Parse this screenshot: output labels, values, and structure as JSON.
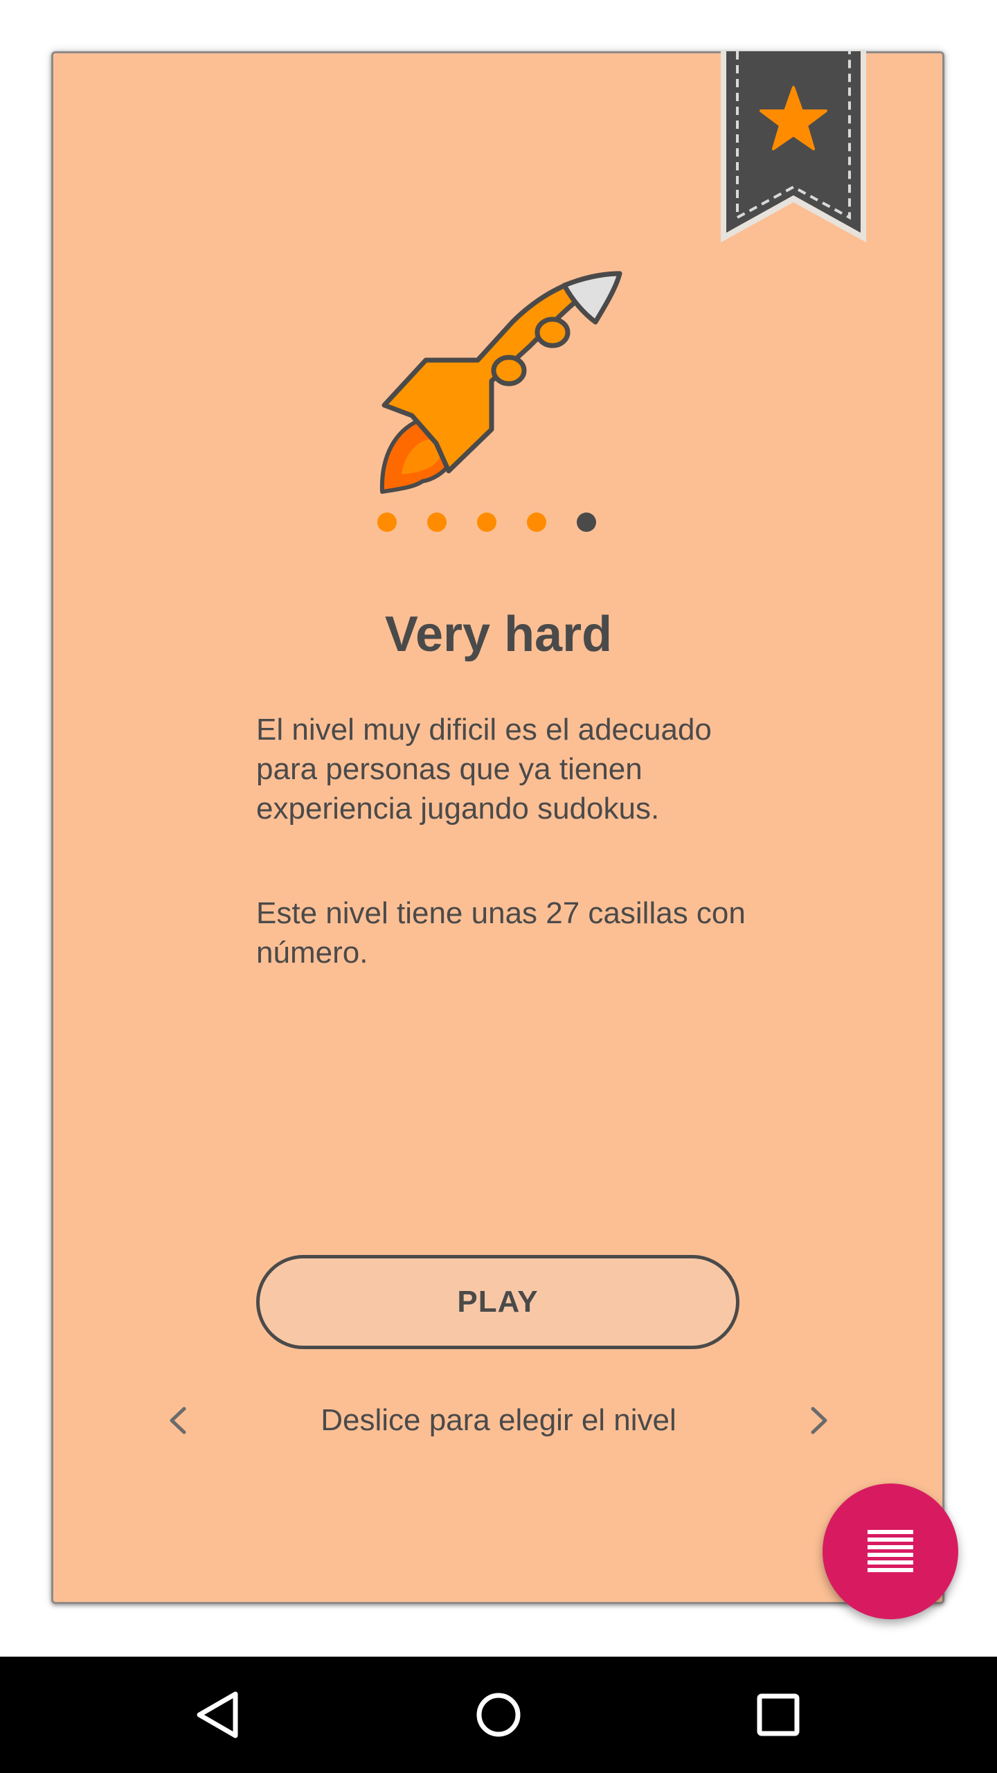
{
  "level": {
    "title": "Very hard",
    "description_1": "El nivel muy dificil es el adecuado para personas que ya tienen experiencia jugando sudokus.",
    "description_2": "Este nivel tiene unas 27 casillas con número.",
    "play_label": "PLAY",
    "swipe_hint": "Deslice para elegir el nivel",
    "page_count": 5,
    "current_page": 5
  },
  "icons": {
    "bookmark": "bookmark-star-icon",
    "level": "rocket-icon",
    "prev": "chevron-left-icon",
    "next": "chevron-right-icon",
    "fab": "list-icon",
    "nav_back": "back-triangle-icon",
    "nav_home": "home-circle-icon",
    "nav_recent": "recent-square-icon"
  },
  "colors": {
    "card_background": "#fcbf94",
    "accent_orange": "#ff8c00",
    "text_dark": "#4a4a4a",
    "fab": "#d81b60",
    "nav_bar": "#000000"
  }
}
